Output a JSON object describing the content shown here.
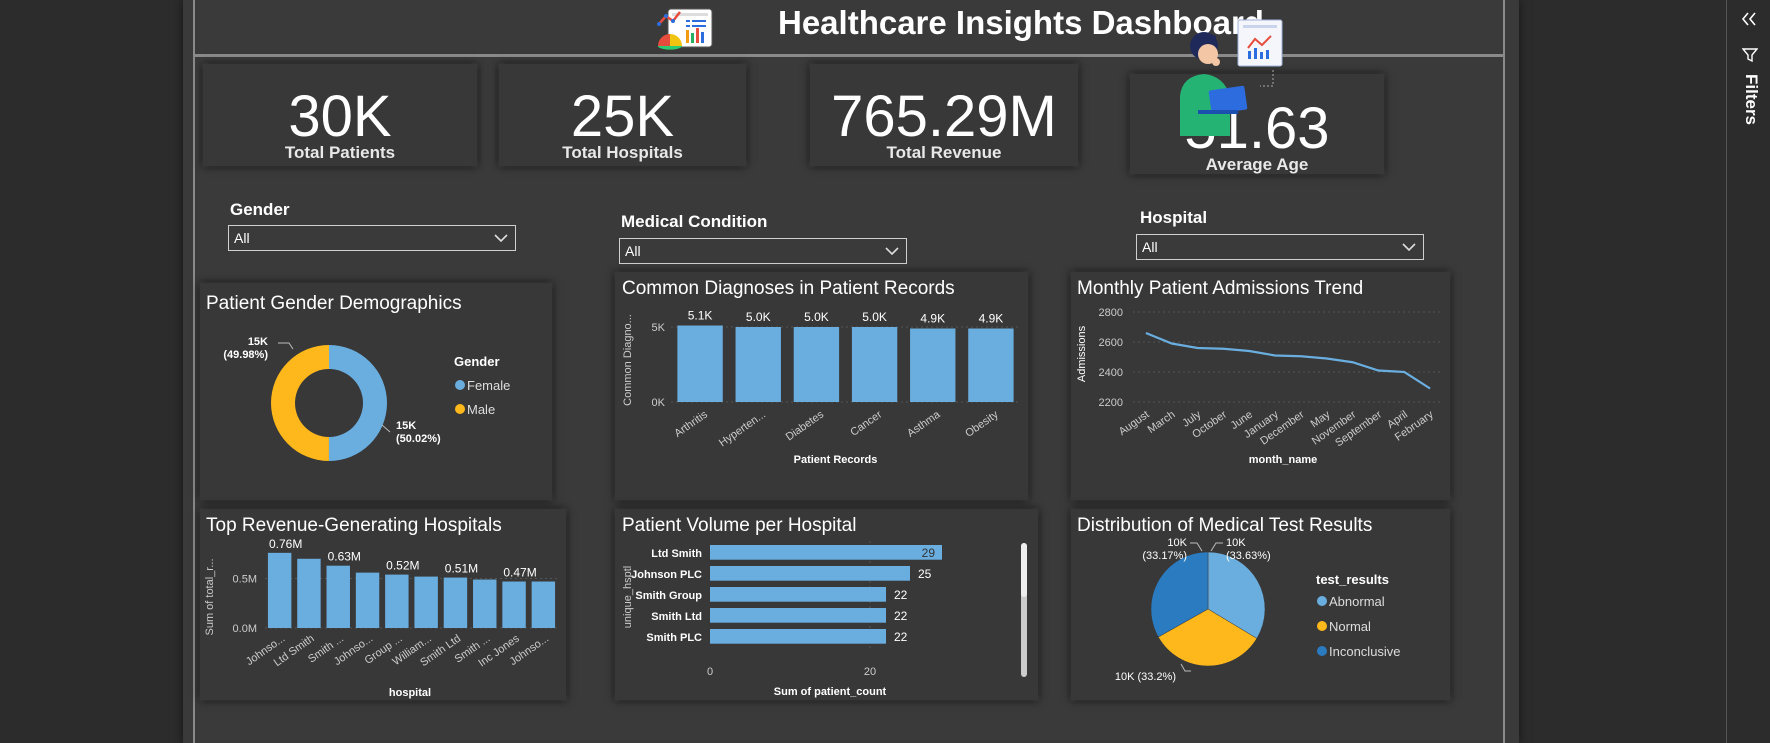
{
  "header": {
    "title": "Healthcare Insights Dashboard"
  },
  "kpis": {
    "patients": {
      "value": "30K",
      "label": "Total Patients"
    },
    "hospitals": {
      "value": "25K",
      "label": "Total Hospitals"
    },
    "revenue": {
      "value": "765.29M",
      "label": "Total Revenue"
    },
    "age": {
      "value": "51.63",
      "label": "Average Age"
    }
  },
  "slicers": {
    "gender": {
      "title": "Gender",
      "value": "All"
    },
    "condition": {
      "title": "Medical Condition",
      "value": "All"
    },
    "hospital": {
      "title": "Hospital",
      "value": "All"
    }
  },
  "filters_pane": {
    "label": "Filters"
  },
  "colors": {
    "blue": "#6aaee0",
    "yellow": "#ffb81c",
    "dark_blue": "#2b7bc1",
    "card_bg": "#383838"
  },
  "chart_data": [
    {
      "id": "gender",
      "type": "pie",
      "title": "Patient Gender Demographics",
      "legend_title": "Gender",
      "labels": [
        "Female",
        "Male"
      ],
      "values": [
        15006,
        14994
      ],
      "value_labels": [
        "15K",
        "15K"
      ],
      "percent_labels": [
        "(50.02%)",
        "(49.98%)"
      ],
      "legend": "right"
    },
    {
      "id": "diagnoses",
      "type": "bar",
      "title": "Common Diagnoses in Patient Records",
      "categories": [
        "Arthritis",
        "Hyperten...",
        "Diabetes",
        "Cancer",
        "Asthma",
        "Obesity"
      ],
      "values": [
        5100,
        5000,
        5000,
        5000,
        4900,
        4900
      ],
      "data_labels": [
        "5.1K",
        "5.0K",
        "5.0K",
        "5.0K",
        "4.9K",
        "4.9K"
      ],
      "yticks": [
        "0K",
        "5K"
      ],
      "ylim": [
        0,
        6000
      ],
      "xlabel": "Patient Records",
      "ylabel": "Common Diagno..."
    },
    {
      "id": "admissions",
      "type": "line",
      "title": "Monthly Patient Admissions Trend",
      "categories": [
        "August",
        "March",
        "July",
        "October",
        "June",
        "January",
        "December",
        "May",
        "November",
        "September",
        "April",
        "February"
      ],
      "values": [
        2660,
        2590,
        2560,
        2555,
        2540,
        2510,
        2505,
        2490,
        2465,
        2410,
        2400,
        2290
      ],
      "yticks": [
        "2200",
        "2400",
        "2600",
        "2800"
      ],
      "ylim": [
        2200,
        2800
      ],
      "xlabel": "month_name",
      "ylabel": "Admissions"
    },
    {
      "id": "revenue",
      "type": "bar",
      "title": "Top Revenue-Generating Hospitals",
      "categories": [
        "Johnso...",
        "Ltd Smith",
        "Smith ...",
        "Johnso...",
        "Group ...",
        "William...",
        "Smith Ltd",
        "Smith ...",
        "Inc Jones",
        "Johnso..."
      ],
      "values": [
        0.76,
        0.7,
        0.63,
        0.56,
        0.54,
        0.52,
        0.51,
        0.49,
        0.47,
        0.47
      ],
      "data_labels": [
        "0.76M",
        "",
        "0.63M",
        "",
        "0.52M",
        "",
        "0.51M",
        "",
        "0.47M",
        ""
      ],
      "yticks": [
        "0.0M",
        "0.5M"
      ],
      "ylim": [
        0,
        0.9
      ],
      "xlabel": "hospital",
      "ylabel": "Sum of total_r..."
    },
    {
      "id": "volume",
      "type": "bar",
      "orientation": "horizontal",
      "title": "Patient Volume per Hospital",
      "categories": [
        "Ltd Smith",
        "Johnson PLC",
        "Smith Group",
        "Smith Ltd",
        "Smith PLC"
      ],
      "values": [
        29,
        25,
        22,
        22,
        22
      ],
      "xticks": [
        "0",
        "20"
      ],
      "xlim": [
        0,
        30
      ],
      "xlabel": "Sum of patient_count",
      "ylabel": "unique_hsptl"
    },
    {
      "id": "tests",
      "type": "pie",
      "title": "Distribution of Medical Test Results",
      "legend_title": "test_results",
      "labels": [
        "Abnormal",
        "Normal",
        "Inconclusive"
      ],
      "values": [
        33.63,
        33.2,
        33.17
      ],
      "data_labels": [
        "10K\n(33.63%)",
        "10K (33.2%)",
        "10K\n(33.17%)"
      ],
      "legend": "right"
    }
  ]
}
